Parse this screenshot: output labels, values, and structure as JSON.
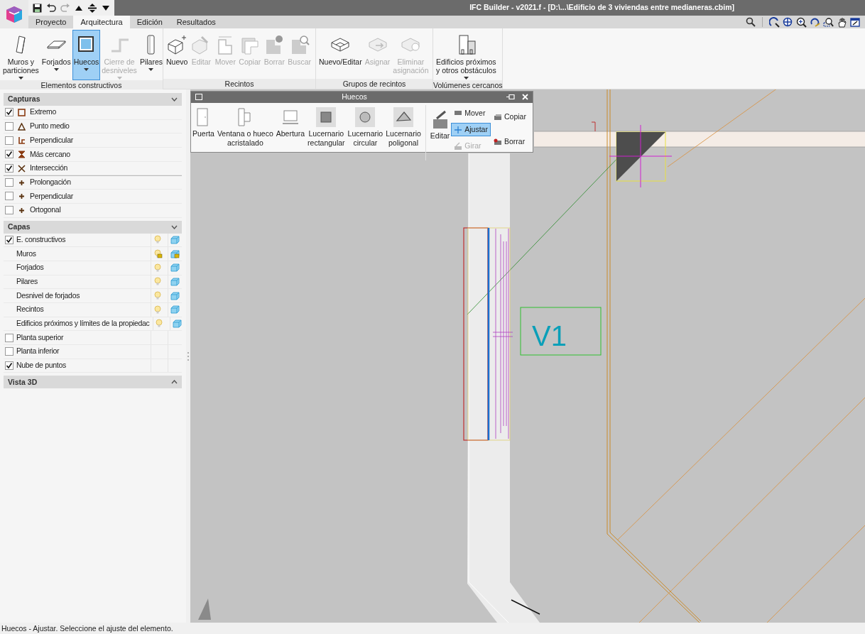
{
  "window": {
    "title": "IFC Builder - v2021.f - [D:\\...\\Edificio de 3 viviendas entre medianeras.cbim]"
  },
  "tabs": [
    {
      "label": "Proyecto",
      "selected": false
    },
    {
      "label": "Arquitectura",
      "selected": true
    },
    {
      "label": "Edición",
      "selected": false
    },
    {
      "label": "Resultados",
      "selected": false
    }
  ],
  "ribbon": [
    {
      "label": "Elementos constructivos",
      "buttons": [
        {
          "label": "Muros y\nparticiones",
          "dropdown": true,
          "disabled": false,
          "selected": false
        },
        {
          "label": "Forjados",
          "dropdown": true,
          "disabled": false,
          "selected": false
        },
        {
          "label": "Huecos",
          "dropdown": true,
          "disabled": false,
          "selected": true
        },
        {
          "label": "Cierre de\ndesniveles",
          "dropdown": true,
          "disabled": true,
          "selected": false
        },
        {
          "label": "Pilares",
          "dropdown": true,
          "disabled": false,
          "selected": false
        }
      ]
    },
    {
      "label": "Recintos",
      "buttons": [
        {
          "label": "Nuevo",
          "dropdown": false,
          "disabled": false,
          "selected": false
        },
        {
          "label": "Editar",
          "dropdown": false,
          "disabled": true,
          "selected": false
        },
        {
          "label": "Mover",
          "dropdown": false,
          "disabled": true,
          "selected": false
        },
        {
          "label": "Copiar",
          "dropdown": false,
          "disabled": true,
          "selected": false
        },
        {
          "label": "Borrar",
          "dropdown": false,
          "disabled": true,
          "selected": false
        },
        {
          "label": "Buscar",
          "dropdown": false,
          "disabled": true,
          "selected": false
        }
      ]
    },
    {
      "label": "Grupos de recintos",
      "buttons": [
        {
          "label": "Nuevo/Editar",
          "dropdown": false,
          "disabled": false,
          "selected": false
        },
        {
          "label": "Asignar",
          "dropdown": false,
          "disabled": true,
          "selected": false
        },
        {
          "label": "Eliminar\nasignación",
          "dropdown": false,
          "disabled": true,
          "selected": false
        }
      ]
    },
    {
      "label": "Volúmenes cercanos",
      "buttons": [
        {
          "label": "Edificios próximos\ny otros obstáculos",
          "dropdown": true,
          "disabled": false,
          "selected": false
        }
      ]
    }
  ],
  "captures": {
    "title": "Capturas",
    "expanded": true,
    "groups": [
      [
        {
          "label": "Extremo",
          "checked": true
        },
        {
          "label": "Punto medio",
          "checked": false
        },
        {
          "label": "Perpendicular",
          "checked": false
        },
        {
          "label": "Más cercano",
          "checked": true
        },
        {
          "label": "Intersección",
          "checked": true
        }
      ],
      [
        {
          "label": "Prolongación",
          "checked": false
        },
        {
          "label": "Perpendicular",
          "checked": false
        },
        {
          "label": "Ortogonal",
          "checked": false
        }
      ]
    ]
  },
  "layers": {
    "title": "Capas",
    "expanded": true,
    "items": [
      {
        "label": "E. constructivos",
        "checked": true,
        "children": [
          {
            "label": "Muros",
            "locked": true
          },
          {
            "label": "Forjados",
            "locked": false
          },
          {
            "label": "Pilares",
            "locked": false
          },
          {
            "label": "Desnivel de forjados",
            "locked": false
          },
          {
            "label": "Recintos",
            "locked": false
          },
          {
            "label": "Edificios próximos y límites de la propiedac",
            "locked": false
          }
        ]
      },
      {
        "label": "Planta superior",
        "checked": false
      },
      {
        "label": "Planta inferior",
        "checked": false
      },
      {
        "label": "Nube de puntos",
        "checked": true
      }
    ]
  },
  "view3d": {
    "title": "Vista 3D",
    "expanded": false
  },
  "huecos_panel": {
    "title": "Huecos",
    "tools": [
      {
        "label": "Puerta"
      },
      {
        "label": "Ventana o hueco\nacristalado"
      },
      {
        "label": "Abertura"
      },
      {
        "label": "Lucernario\nrectangular"
      },
      {
        "label": "Lucernario\ncircular"
      },
      {
        "label": "Lucernario\npoligonal"
      }
    ],
    "edit": "Editar",
    "actions": [
      {
        "label": "Mover",
        "selected": false,
        "disabled": false
      },
      {
        "label": "Ajustar",
        "selected": true,
        "disabled": false
      },
      {
        "label": "Girar",
        "selected": false,
        "disabled": true
      }
    ],
    "actions2": [
      {
        "label": "Copiar",
        "selected": false,
        "disabled": false
      },
      {
        "label": "Borrar",
        "selected": false,
        "disabled": false
      }
    ]
  },
  "canvas": {
    "room_label": "V1"
  },
  "status_bar": "Huecos - Ajustar. Seleccione el ajuste del elemento."
}
